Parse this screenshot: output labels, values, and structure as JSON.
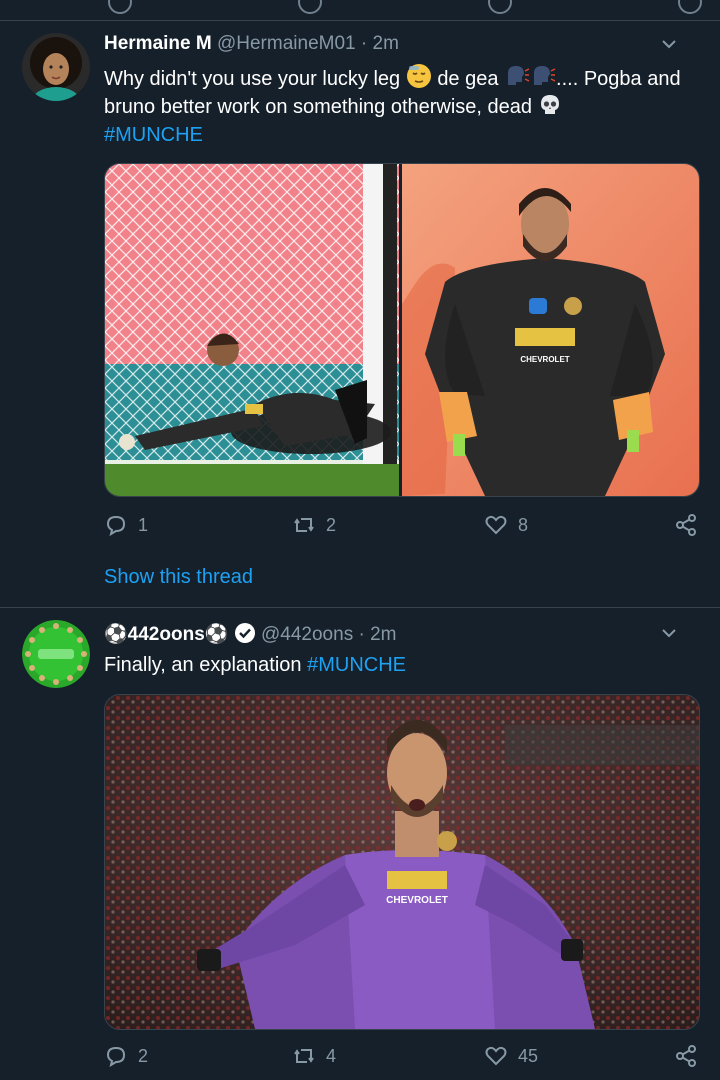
{
  "tweets": [
    {
      "name": "Hermaine M",
      "handle": "@HermaineM01",
      "dot": "·",
      "time": "2m",
      "text_1": "Why didn't you use your lucky leg",
      "text_2": "de gea",
      "text_3": ".... Pogba and",
      "text_line2": "bruno better work on something otherwise,  dead",
      "hashtag": "#MUNCHE",
      "reply_count": "1",
      "retweet_count": "2",
      "like_count": "8",
      "images": [
        "de-gea-goal-net-photo",
        "de-gea-hands-on-hips-photo"
      ]
    },
    {
      "name_prefix": "⚽",
      "name": "442oons",
      "name_suffix": "⚽",
      "verified": true,
      "handle": "@442oons",
      "dot": "·",
      "time": "2m",
      "text": "Finally, an explanation",
      "hashtag": "#MUNCHE",
      "reply_count": "2",
      "retweet_count": "4",
      "like_count": "45",
      "images": [
        "de-gea-purple-kit-photo"
      ]
    }
  ],
  "show_thread": "Show this thread",
  "colors": {
    "background": "#15202b",
    "accent": "#1da1f2",
    "muted": "#8899a6",
    "divider": "#38444d"
  },
  "kit_text": {
    "sponsor": "CHEVROLET"
  }
}
